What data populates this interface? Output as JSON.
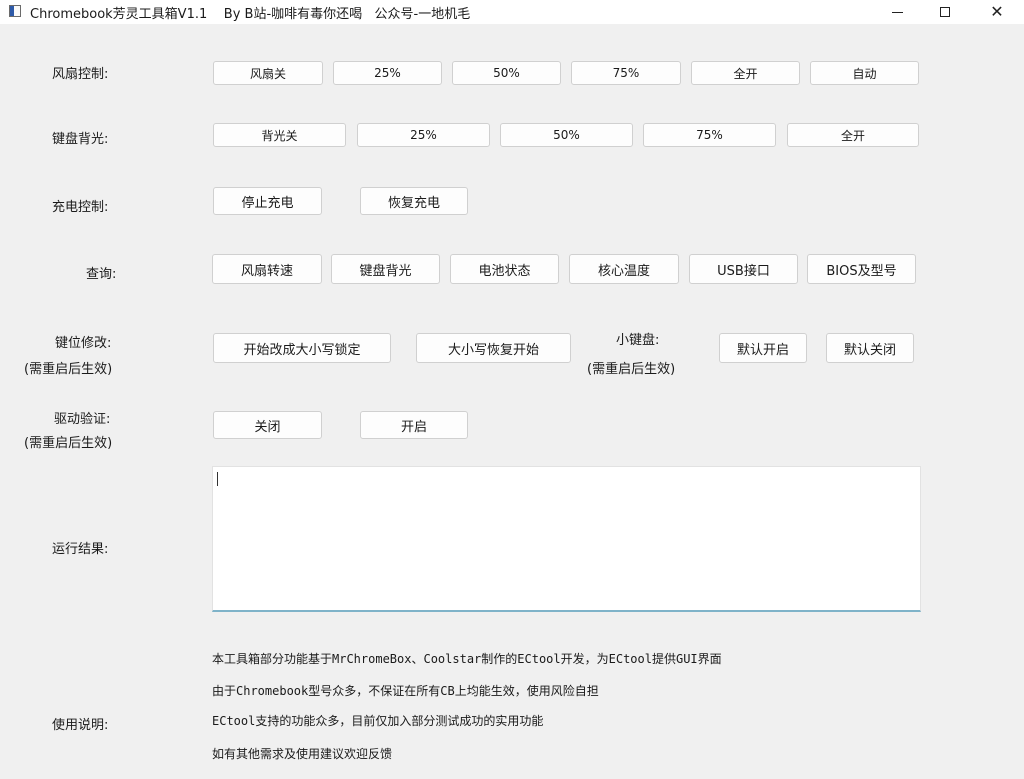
{
  "window": {
    "title": "Chromebook芳灵工具箱V1.1    By B站-咖啡有毒你还喝   公众号-一地机毛",
    "icon": "app-icon",
    "controls": {
      "minimize": "minimize-icon",
      "maximize": "maximize-icon",
      "close": "close-icon"
    }
  },
  "fan": {
    "label": "风扇控制:",
    "buttons": [
      "风扇关",
      "25%",
      "50%",
      "75%",
      "全开",
      "自动"
    ]
  },
  "backlight": {
    "label": "键盘背光:",
    "buttons": [
      "背光关",
      "25%",
      "50%",
      "75%",
      "全开"
    ]
  },
  "charge": {
    "label": "充电控制:",
    "buttons": [
      "停止充电",
      "恢复充电"
    ]
  },
  "query": {
    "label": "查询:",
    "buttons": [
      "风扇转速",
      "键盘背光",
      "电池状态",
      "核心温度",
      "USB接口",
      "BIOS及型号"
    ]
  },
  "keymap": {
    "label": "键位修改:",
    "note": "(需重启后生效)",
    "buttons": [
      "开始改成大小写锁定",
      "大小写恢复开始"
    ]
  },
  "minikeyboard": {
    "label": "小键盘:",
    "note": "(需重启后生效)",
    "buttons": [
      "默认开启",
      "默认关闭"
    ]
  },
  "driver": {
    "label": "驱动验证:",
    "note": "(需重启后生效)",
    "buttons": [
      "关闭",
      "开启"
    ]
  },
  "result": {
    "label": "运行结果:",
    "value": ""
  },
  "usage": {
    "label": "使用说明:",
    "lines": [
      "本工具箱部分功能基于MrChromeBox、Coolstar制作的ECtool开发，为ECtool提供GUI界面",
      "由于Chromebook型号众多，不保证在所有CB上均能生效，使用风险自担",
      "ECtool支持的功能众多，目前仅加入部分测试成功的实用功能",
      "如有其他需求及使用建议欢迎反馈"
    ]
  }
}
